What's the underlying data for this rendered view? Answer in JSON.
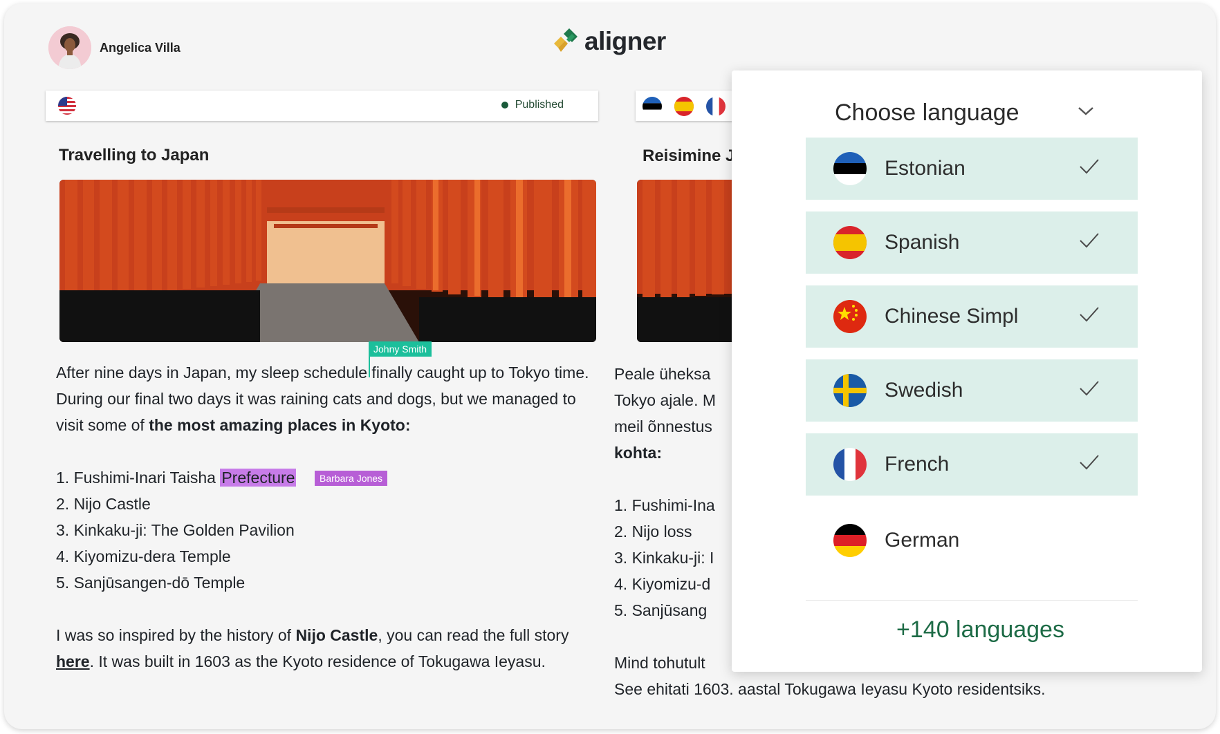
{
  "user": {
    "name": "Angelica Villa"
  },
  "app": {
    "logo_text": "aligner"
  },
  "source": {
    "status": "Published",
    "title": "Travelling to Japan",
    "paragraph1_pre": "After nine days in Japan, my sleep schedule finally caught up to Tokyo time. During our final two days it was raining cats and dogs, but we managed to visit some of ",
    "paragraph1_bold": "the most amazing places in Kyoto:",
    "list": [
      {
        "pre": "1. Fushimi-Inari Taisha ",
        "highlight": "Prefecture"
      },
      {
        "pre": "2. Nijo Castle"
      },
      {
        "pre": "3. Kinkaku-ji: The Golden Pavilion"
      },
      {
        "pre": "4. Kiyomizu-dera Temple"
      },
      {
        "pre": "5. Sanjūsangen-dō Temple"
      }
    ],
    "paragraph2_pre": "I was so inspired by the history of ",
    "paragraph2_bold": "Nijo Castle",
    "paragraph2_mid": ", you can read the full story ",
    "paragraph2_link": "here",
    "paragraph2_post": ". It was built in 1603 as the Kyoto residence of Tokugawa Ieyasu.",
    "collaborators": {
      "cursor_user": "Johny Smith",
      "highlight_user": "Barbara Jones"
    }
  },
  "target": {
    "title": "Reisimine J",
    "lines": [
      "Peale üheksa",
      "Tokyo ajale. M",
      "meil õnnestus"
    ],
    "bold_line": "kohta:",
    "list": [
      "1. Fushimi-Ina",
      "2. Nijo loss",
      "3. Kinkaku-ji: I",
      "4. Kiyomizu-d",
      "5. Sanjūsang"
    ],
    "paragraph2_line1": "Mind tohutult",
    "paragraph2_line2": "See ehitati 1603. aastal Tokugawa Ieyasu Kyoto residentsiks."
  },
  "language_panel": {
    "title": "Choose language",
    "languages": [
      {
        "name": "Estonian",
        "selected": true
      },
      {
        "name": "Spanish",
        "selected": true
      },
      {
        "name": "Chinese Simpl",
        "selected": true
      },
      {
        "name": "Swedish",
        "selected": true
      },
      {
        "name": "French",
        "selected": true
      },
      {
        "name": "German",
        "selected": false
      }
    ],
    "more": "+140 languages"
  },
  "colors": {
    "accent_green": "#1d6b46",
    "selected_bg": "#dcefea",
    "cursor_tag": "#1cbf9b",
    "highlight_tag": "#b75ed6"
  }
}
